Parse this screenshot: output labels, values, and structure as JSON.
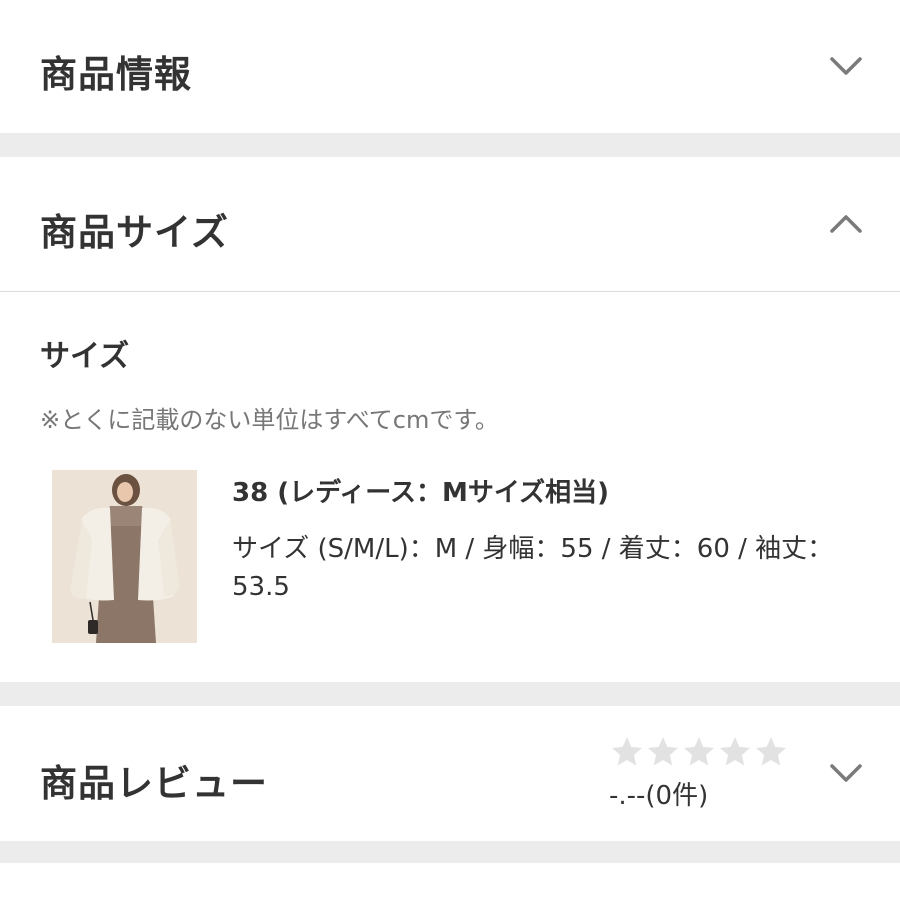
{
  "sections": {
    "info": {
      "title": "商品情報",
      "expanded": false,
      "chevron_icon": "chevron-down-icon"
    },
    "size": {
      "title": "商品サイズ",
      "expanded": true,
      "chevron_icon": "chevron-up-icon"
    },
    "review": {
      "title": "商品レビュー",
      "expanded": false,
      "chevron_icon": "chevron-down-icon"
    }
  },
  "size_panel": {
    "heading": "サイズ",
    "note": "※とくに記載のない単位はすべてcmです。",
    "item": {
      "image_icon": "product-photo",
      "name": "38 (レディース：Mサイズ相当)",
      "detail": "サイズ (S/M/L)：M / 身幅：55 / 着丈：60 / 袖丈：53.5"
    }
  },
  "review": {
    "stars_filled": 0,
    "stars_total": 5,
    "rating_text": "-.--(0件)",
    "star_color_empty": "#e2e2e2"
  },
  "colors": {
    "separator": "#ececec",
    "divider": "#dcdcdc",
    "text": "#333333",
    "muted": "#777777",
    "chevron": "#7a7a7a"
  }
}
